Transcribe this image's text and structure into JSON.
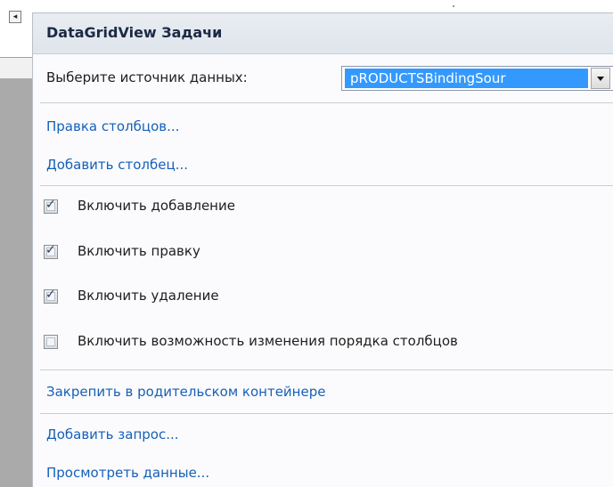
{
  "panel": {
    "title": "DataGridView Задачи"
  },
  "data_source": {
    "label": "Выберите источник данных:",
    "value": "pRODUCTSBindingSour",
    "dropdown_icon": "chevron-down-icon"
  },
  "links_top": [
    {
      "label": "Правка столбцов..."
    },
    {
      "label": "Добавить столбец..."
    }
  ],
  "options": [
    {
      "label": "Включить добавление",
      "checked": true
    },
    {
      "label": "Включить правку",
      "checked": true
    },
    {
      "label": "Включить удаление",
      "checked": true
    },
    {
      "label": "Включить возможность изменения порядка столбцов",
      "checked": false
    }
  ],
  "dock_link": {
    "label": "Закрепить в родительском контейнере"
  },
  "links_bottom": [
    {
      "label": "Добавить запрос..."
    },
    {
      "label": "Просмотреть данные..."
    }
  ],
  "colors": {
    "link": "#1660b8",
    "selection": "#3399ff",
    "header_bg": "#e3e8ee"
  }
}
